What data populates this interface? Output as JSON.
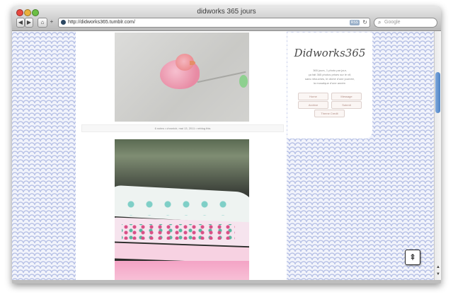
{
  "window": {
    "title": "didworks 365 jours"
  },
  "toolbar": {
    "back_glyph": "◀",
    "forward_glyph": "▶",
    "home_glyph": "⌂",
    "add_glyph": "+",
    "url": "http://didworks365.tumblr.com/",
    "rss_label": "RSS",
    "reload_glyph": "↻",
    "search_placeholder": "Google",
    "search_glyph": "⌕"
  },
  "post1": {
    "info": "6 notes • chroniclr, mai 13, 2011 • reblog this"
  },
  "sidebar": {
    "logo": "Didworks365",
    "tagline_1": "365 jours, 1 photo par jour,",
    "tagline_2": "ça fait 365 photos prises sur le vif,",
    "tagline_3": "sans retouches, le cliché d'une journée,",
    "tagline_4": "la mosaïque d'une année.",
    "links": [
      {
        "label": "Home"
      },
      {
        "label": "Message"
      },
      {
        "label": "Archive"
      },
      {
        "label": "Submit"
      },
      {
        "label": "Theme Credit"
      }
    ]
  },
  "scroll_top_glyph": "⇞",
  "icons": [
    "back-icon",
    "forward-icon",
    "home-icon",
    "add-icon",
    "favicon",
    "rss-icon",
    "reload-icon",
    "search-icon",
    "scroll-top-icon"
  ]
}
